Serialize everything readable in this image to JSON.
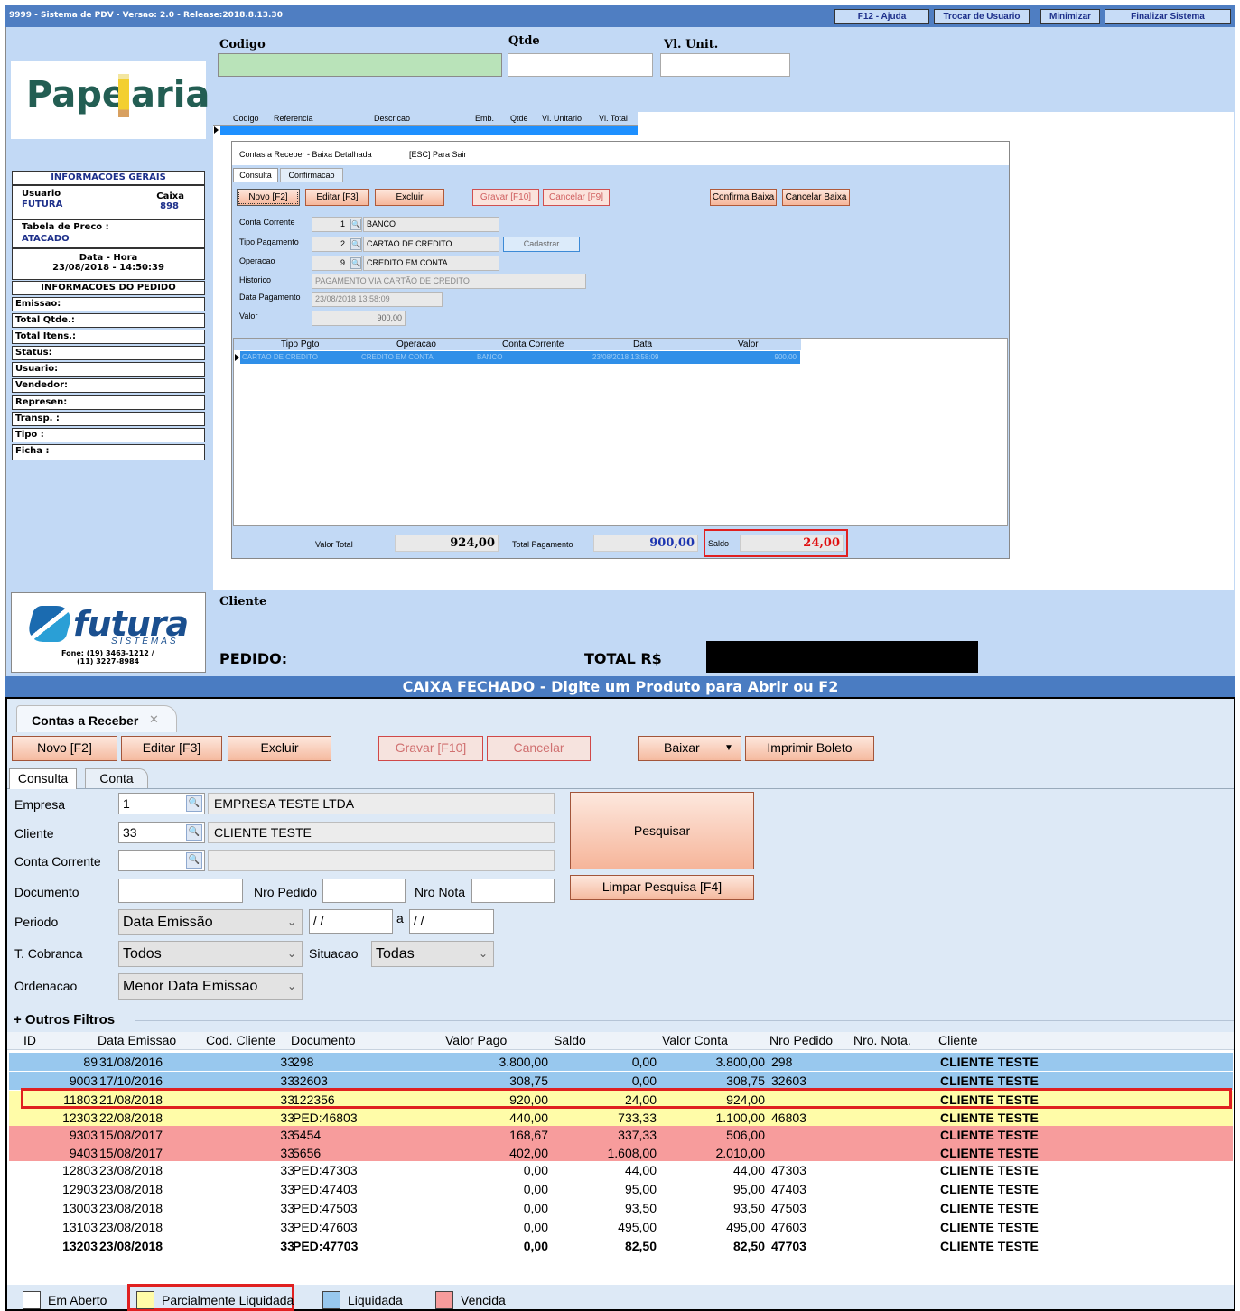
{
  "titlebar": {
    "title": "9999 - Sistema de PDV - Versao: 2.0 - Release:2018.8.13.30",
    "buttons": [
      "F12 - Ajuda",
      "Trocar de Usuario",
      "Minimizar",
      "Finalizar Sistema"
    ]
  },
  "top_fields": {
    "codigo": "Codigo",
    "qtde": "Qtde",
    "vl_unit": "Vl. Unit."
  },
  "logo": {
    "text_a": "Pape",
    "text_b": "aria"
  },
  "info": {
    "header": "INFORMACOES GERAIS",
    "usuario_label": "Usuario",
    "usuario_value": "FUTURA",
    "caixa_label": "Caixa",
    "caixa_value": "898",
    "tabela_label": "Tabela de Preco :",
    "tabela_value": "ATACADO",
    "data_label": "Data - Hora",
    "data_value": "23/08/2018 - 14:50:39",
    "pedido_header": "INFORMACOES DO PEDIDO",
    "fields": [
      "Emissao:",
      "Total Qtde.:",
      "Total Itens.:",
      "Status:",
      "Usuario:",
      "Vendedor:",
      "Represen:",
      "Transp. :",
      "Tipo :",
      "Ficha :"
    ]
  },
  "futura": {
    "name": "futura",
    "sub": "SISTEMAS",
    "phone1": "Fone: (19) 3463-1212 /",
    "phone2": "(11) 3227-8984"
  },
  "grid_header": [
    "Codigo",
    "Referencia",
    "Descricao",
    "Emb.",
    "Qtde",
    "Vl. Unitario",
    "Vl. Total"
  ],
  "dialog": {
    "title": "Contas a Receber - Baixa Detalhada",
    "esc": "[ESC] Para Sair",
    "tabs": [
      "Consulta",
      "Confirmacao"
    ],
    "buttons": {
      "novo": "Novo [F2]",
      "editar": "Editar [F3]",
      "excluir": "Excluir",
      "gravar": "Gravar [F10]",
      "cancelar": "Cancelar [F9]",
      "confirma": "Confirma Baixa",
      "cancelar_baixa": "Cancelar Baixa",
      "cadastrar": "Cadastrar"
    },
    "fields": {
      "conta_label": "Conta Corrente",
      "conta_code": "1",
      "conta_desc": "BANCO",
      "tipo_label": "Tipo Pagamento",
      "tipo_code": "2",
      "tipo_desc": "CARTAO DE CREDITO",
      "oper_label": "Operacao",
      "oper_code": "9",
      "oper_desc": "CREDITO EM CONTA",
      "hist_label": "Historico",
      "hist_value": "PAGAMENTO VIA CARTÃO DE CREDITO",
      "datapag_label": "Data Pagamento",
      "datapag_value": "23/08/2018 13:58:09",
      "valor_label": "Valor",
      "valor_value": "900,00"
    },
    "grid_cols": [
      "Tipo Pgto",
      "Operacao",
      "Conta Corrente",
      "Data",
      "Valor"
    ],
    "grid_row": [
      "CARTAO DE CREDITO",
      "CREDITO EM CONTA",
      "BANCO",
      "23/08/2018 13:58:09",
      "900,00"
    ],
    "footer": {
      "valor_total_label": "Valor Total",
      "valor_total": "924,00",
      "total_pag_label": "Total Pagamento",
      "total_pag": "900,00",
      "saldo_label": "Saldo",
      "saldo": "24,00"
    }
  },
  "cliente_label": "Cliente",
  "pedido_label": "PEDIDO:",
  "total_label": "TOTAL R$",
  "status_bar": "CAIXA FECHADO - Digite um Produto para Abrir ou F2",
  "contas": {
    "tab": "Contas a Receber",
    "buttons": {
      "novo": "Novo [F2]",
      "editar": "Editar [F3]",
      "excluir": "Excluir",
      "gravar": "Gravar [F10]",
      "cancelar": "Cancelar",
      "baixar": "Baixar",
      "imprimir": "Imprimir Boleto",
      "pesquisar": "Pesquisar",
      "limpar": "Limpar Pesquisa [F4]"
    },
    "subtabs": [
      "Consulta",
      "Conta"
    ],
    "filters": {
      "empresa_label": "Empresa",
      "empresa_code": "1",
      "empresa_desc": "EMPRESA TESTE LTDA",
      "cliente_label": "Cliente",
      "cliente_code": "33",
      "cliente_desc": "CLIENTE TESTE",
      "conta_label": "Conta Corrente",
      "documento_label": "Documento",
      "nro_pedido_label": "Nro Pedido",
      "nro_nota_label": "Nro Nota",
      "periodo_label": "Periodo",
      "periodo_value": "Data Emissão",
      "date_from": " / /",
      "a_label": "a",
      "date_to": " / /",
      "cobranca_label": "T. Cobranca",
      "cobranca_value": "Todos",
      "situacao_label": "Situacao",
      "situacao_value": "Todas",
      "ordenacao_label": "Ordenacao",
      "ordenacao_value": "Menor Data Emissao",
      "outros": "+ Outros Filtros"
    },
    "columns": [
      "ID",
      "Data Emissao",
      "Cod. Cliente",
      "Documento",
      "Valor Pago",
      "Saldo",
      "Valor Conta",
      "Nro Pedido",
      "Nro. Nota.",
      "Cliente"
    ],
    "rows": [
      {
        "id": "89",
        "data": "31/08/2016",
        "cod": "33",
        "doc": "298",
        "pago": "3.800,00",
        "saldo": "0,00",
        "conta": "3.800,00",
        "pedido": "298",
        "nota": "",
        "cliente": "CLIENTE TESTE",
        "status": "liquidada"
      },
      {
        "id": "9003",
        "data": "17/10/2016",
        "cod": "33",
        "doc": "32603",
        "pago": "308,75",
        "saldo": "0,00",
        "conta": "308,75",
        "pedido": "32603",
        "nota": "",
        "cliente": "CLIENTE TESTE",
        "status": "liquidada"
      },
      {
        "id": "11803",
        "data": "21/08/2018",
        "cod": "33",
        "doc": "122356",
        "pago": "920,00",
        "saldo": "24,00",
        "conta": "924,00",
        "pedido": "",
        "nota": "",
        "cliente": "CLIENTE TESTE",
        "status": "parcial"
      },
      {
        "id": "12303",
        "data": "22/08/2018",
        "cod": "33",
        "doc": "PED:46803",
        "pago": "440,00",
        "saldo": "733,33",
        "conta": "1.100,00",
        "pedido": "46803",
        "nota": "",
        "cliente": "CLIENTE TESTE",
        "status": "parcial"
      },
      {
        "id": "9303",
        "data": "15/08/2017",
        "cod": "33",
        "doc": "5454",
        "pago": "168,67",
        "saldo": "337,33",
        "conta": "506,00",
        "pedido": "",
        "nota": "",
        "cliente": "CLIENTE TESTE",
        "status": "vencida"
      },
      {
        "id": "9403",
        "data": "15/08/2017",
        "cod": "33",
        "doc": "5656",
        "pago": "402,00",
        "saldo": "1.608,00",
        "conta": "2.010,00",
        "pedido": "",
        "nota": "",
        "cliente": "CLIENTE TESTE",
        "status": "vencida"
      },
      {
        "id": "12803",
        "data": "23/08/2018",
        "cod": "33",
        "doc": "PED:47303",
        "pago": "0,00",
        "saldo": "44,00",
        "conta": "44,00",
        "pedido": "47303",
        "nota": "",
        "cliente": "CLIENTE TESTE",
        "status": "aberto"
      },
      {
        "id": "12903",
        "data": "23/08/2018",
        "cod": "33",
        "doc": "PED:47403",
        "pago": "0,00",
        "saldo": "95,00",
        "conta": "95,00",
        "pedido": "47403",
        "nota": "",
        "cliente": "CLIENTE TESTE",
        "status": "aberto"
      },
      {
        "id": "13003",
        "data": "23/08/2018",
        "cod": "33",
        "doc": "PED:47503",
        "pago": "0,00",
        "saldo": "93,50",
        "conta": "93,50",
        "pedido": "47503",
        "nota": "",
        "cliente": "CLIENTE TESTE",
        "status": "aberto"
      },
      {
        "id": "13103",
        "data": "23/08/2018",
        "cod": "33",
        "doc": "PED:47603",
        "pago": "0,00",
        "saldo": "495,00",
        "conta": "495,00",
        "pedido": "47603",
        "nota": "",
        "cliente": "CLIENTE TESTE",
        "status": "aberto"
      },
      {
        "id": "13203",
        "data": "23/08/2018",
        "cod": "33",
        "doc": "PED:47703",
        "pago": "0,00",
        "saldo": "82,50",
        "conta": "82,50",
        "pedido": "47703",
        "nota": "",
        "cliente": "CLIENTE TESTE",
        "status": "aberto"
      }
    ],
    "legend": [
      "Em Aberto",
      "Parcialmente Liquidada",
      "Liquidada",
      "Vencida"
    ]
  },
  "colors": {
    "aberto": "#ffffff",
    "parcial": "#fffca8",
    "liquidada": "#98c8ee",
    "vencida": "#f79c9c",
    "app_bg": "#c2d9f5",
    "status_bar": "#4a7cc2",
    "highlight": "#e02020"
  }
}
